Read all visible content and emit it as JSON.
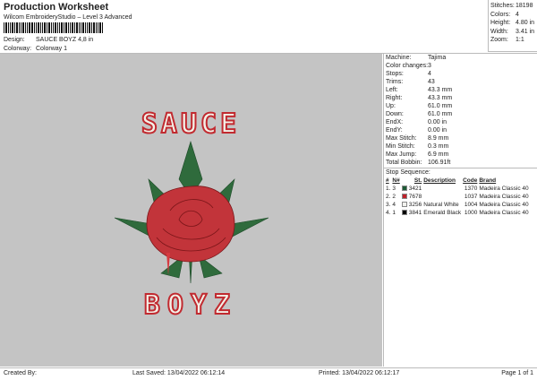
{
  "header": {
    "title": "Production Worksheet",
    "subtitle": "Wilcom EmbroideryStudio – Level 3 Advanced",
    "design_label": "Design:",
    "design_value": "SAUCE BOYZ 4,8 in",
    "colorway_label": "Colorway:",
    "colorway_value": "Colorway 1"
  },
  "stats": [
    {
      "k": "Stitches:",
      "v": "18198"
    },
    {
      "k": "Colors:",
      "v": "4"
    },
    {
      "k": "Height:",
      "v": "4.80 in"
    },
    {
      "k": "Width:",
      "v": "3.41 in"
    },
    {
      "k": "Zoom:",
      "v": "1:1"
    }
  ],
  "details": [
    {
      "k": "Machine:",
      "v": "Tajima"
    },
    {
      "k": "Color changes:",
      "v": "3"
    },
    {
      "k": "Stops:",
      "v": "4"
    },
    {
      "k": "Trims:",
      "v": "43"
    },
    {
      "k": "Left:",
      "v": "43.3 mm"
    },
    {
      "k": "Right:",
      "v": "43.3 mm"
    },
    {
      "k": "Up:",
      "v": "61.0 mm"
    },
    {
      "k": "Down:",
      "v": "61.0 mm"
    },
    {
      "k": "EndX:",
      "v": "0.00 in"
    },
    {
      "k": "EndY:",
      "v": "0.00 in"
    },
    {
      "k": "Max Stitch:",
      "v": "8.9 mm"
    },
    {
      "k": "Min Stitch:",
      "v": "0.3 mm"
    },
    {
      "k": "Max Jump:",
      "v": "6.9 mm"
    },
    {
      "k": "Total Bobbin:",
      "v": "106.91ft"
    }
  ],
  "stop_sequence": {
    "title": "Stop Sequence:",
    "headers": [
      "#",
      "N#",
      "St.",
      "Description",
      "Code",
      "Brand"
    ],
    "rows": [
      {
        "n": "1.",
        "nn": "3",
        "color": "#1e5b36",
        "st": "3421",
        "desc": "",
        "code": "1370",
        "brand": "Madeira Classic 40"
      },
      {
        "n": "2.",
        "nn": "2",
        "color": "#c0202a",
        "st": "7678",
        "desc": "",
        "code": "1037",
        "brand": "Madeira Classic 40"
      },
      {
        "n": "3.",
        "nn": "4",
        "color": "#f2f2ee",
        "st": "3256",
        "desc": "Natural White",
        "code": "1004",
        "brand": "Madeira Classic 40"
      },
      {
        "n": "4.",
        "nn": "1",
        "color": "#000000",
        "st": "3841",
        "desc": "Emerald Black",
        "code": "1000",
        "brand": "Madeira Classic 40"
      }
    ]
  },
  "artwork": {
    "top_text": "SAUCE",
    "bottom_text": "BOYZ"
  },
  "footer": {
    "created_by": "Created By:",
    "last_saved": "Last Saved: 13/04/2022 06:12:14",
    "printed": "Printed: 13/04/2022 06:12:17",
    "page": "Page 1 of 1"
  }
}
